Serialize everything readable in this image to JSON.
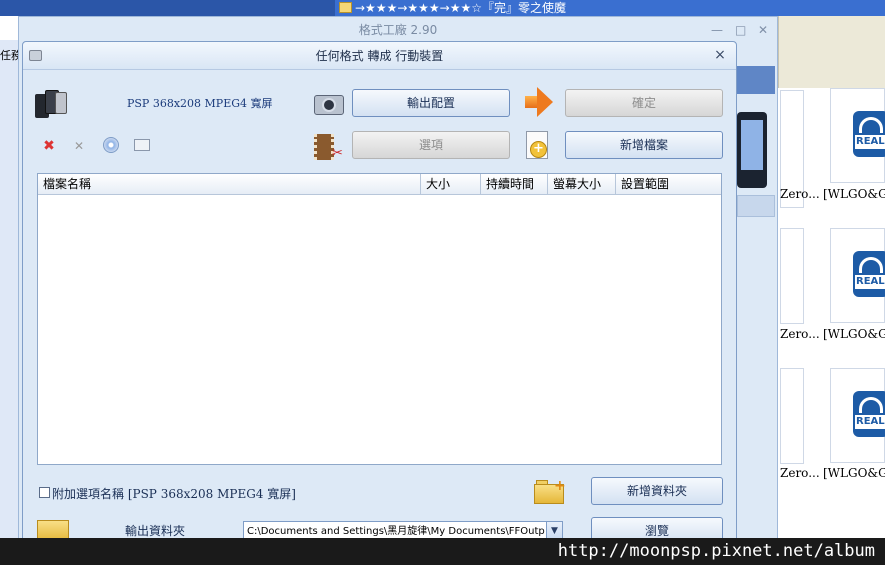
{
  "explorer": {
    "title": "→★★★→★★★→★★☆『完』零之使魔",
    "thumbnails": [
      {
        "left_caption": "Zero...",
        "right_caption": "[WLGO&GB",
        "icon_text": "REAL"
      },
      {
        "left_caption": "Zero...",
        "right_caption": "[WLGO&GB",
        "icon_text": "REAL"
      },
      {
        "left_caption": "Zero...",
        "right_caption": "[WLGO&GB",
        "icon_text": "REAL"
      }
    ],
    "left_panel_label": "任務"
  },
  "main_window": {
    "title": "格式工廠 2.90",
    "minimize": "—",
    "maximize": "□",
    "close": "✕"
  },
  "dialog": {
    "title": "任何格式 轉成 行動裝置",
    "close": "×",
    "profile": "PSP 368x208 MPEG4 寬屏",
    "buttons": {
      "output_config": "輸出配置",
      "ok": "確定",
      "options": "選項",
      "add_file": "新增檔案",
      "add_folder": "新增資料夾",
      "browse": "瀏覽"
    },
    "table": {
      "columns": [
        "檔案名稱",
        "大小",
        "持續時間",
        "螢幕大小",
        "設置範圍"
      ],
      "rows": []
    },
    "append_option": {
      "label_prefix": "附加選項名稱 ",
      "label_value": "[PSP 368x208 MPEG4 寬屏]",
      "checked": false
    },
    "output_folder_label": "輸出資料夾",
    "output_path": "C:\\Documents and Settings\\黑月旋律\\My Documents\\FFOutp"
  },
  "watermark": "http://moonpsp.pixnet.net/album"
}
